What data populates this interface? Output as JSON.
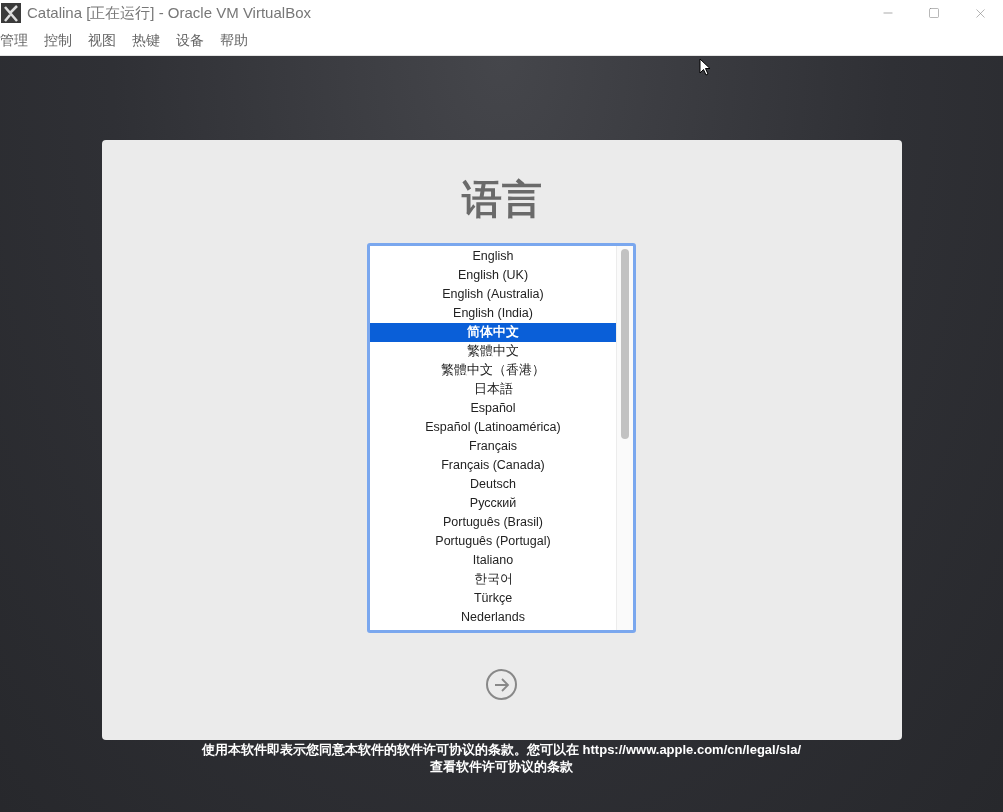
{
  "window": {
    "title": "Catalina [正在运行] - Oracle VM VirtualBox"
  },
  "menu": [
    "管理",
    "控制",
    "视图",
    "热键",
    "设备",
    "帮助"
  ],
  "installer": {
    "heading": "语言",
    "languages": [
      {
        "label": "English",
        "selected": false
      },
      {
        "label": "English (UK)",
        "selected": false
      },
      {
        "label": "English (Australia)",
        "selected": false
      },
      {
        "label": "English (India)",
        "selected": false
      },
      {
        "label": "简体中文",
        "selected": true
      },
      {
        "label": "繁體中文",
        "selected": false
      },
      {
        "label": "繁體中文（香港）",
        "selected": false
      },
      {
        "label": "日本語",
        "selected": false
      },
      {
        "label": "Español",
        "selected": false
      },
      {
        "label": "Español (Latinoamérica)",
        "selected": false
      },
      {
        "label": "Français",
        "selected": false
      },
      {
        "label": "Français (Canada)",
        "selected": false
      },
      {
        "label": "Deutsch",
        "selected": false
      },
      {
        "label": "Русский",
        "selected": false
      },
      {
        "label": "Português (Brasil)",
        "selected": false
      },
      {
        "label": "Português (Portugal)",
        "selected": false
      },
      {
        "label": "Italiano",
        "selected": false
      },
      {
        "label": "한국어",
        "selected": false
      },
      {
        "label": "Türkçe",
        "selected": false
      },
      {
        "label": "Nederlands",
        "selected": false
      }
    ]
  },
  "footer": [
    "使用本软件即表示您同意本软件的软件许可协议的条款。您可以在 https://www.apple.com/cn/legal/sla/",
    "查看软件许可协议的条款"
  ]
}
